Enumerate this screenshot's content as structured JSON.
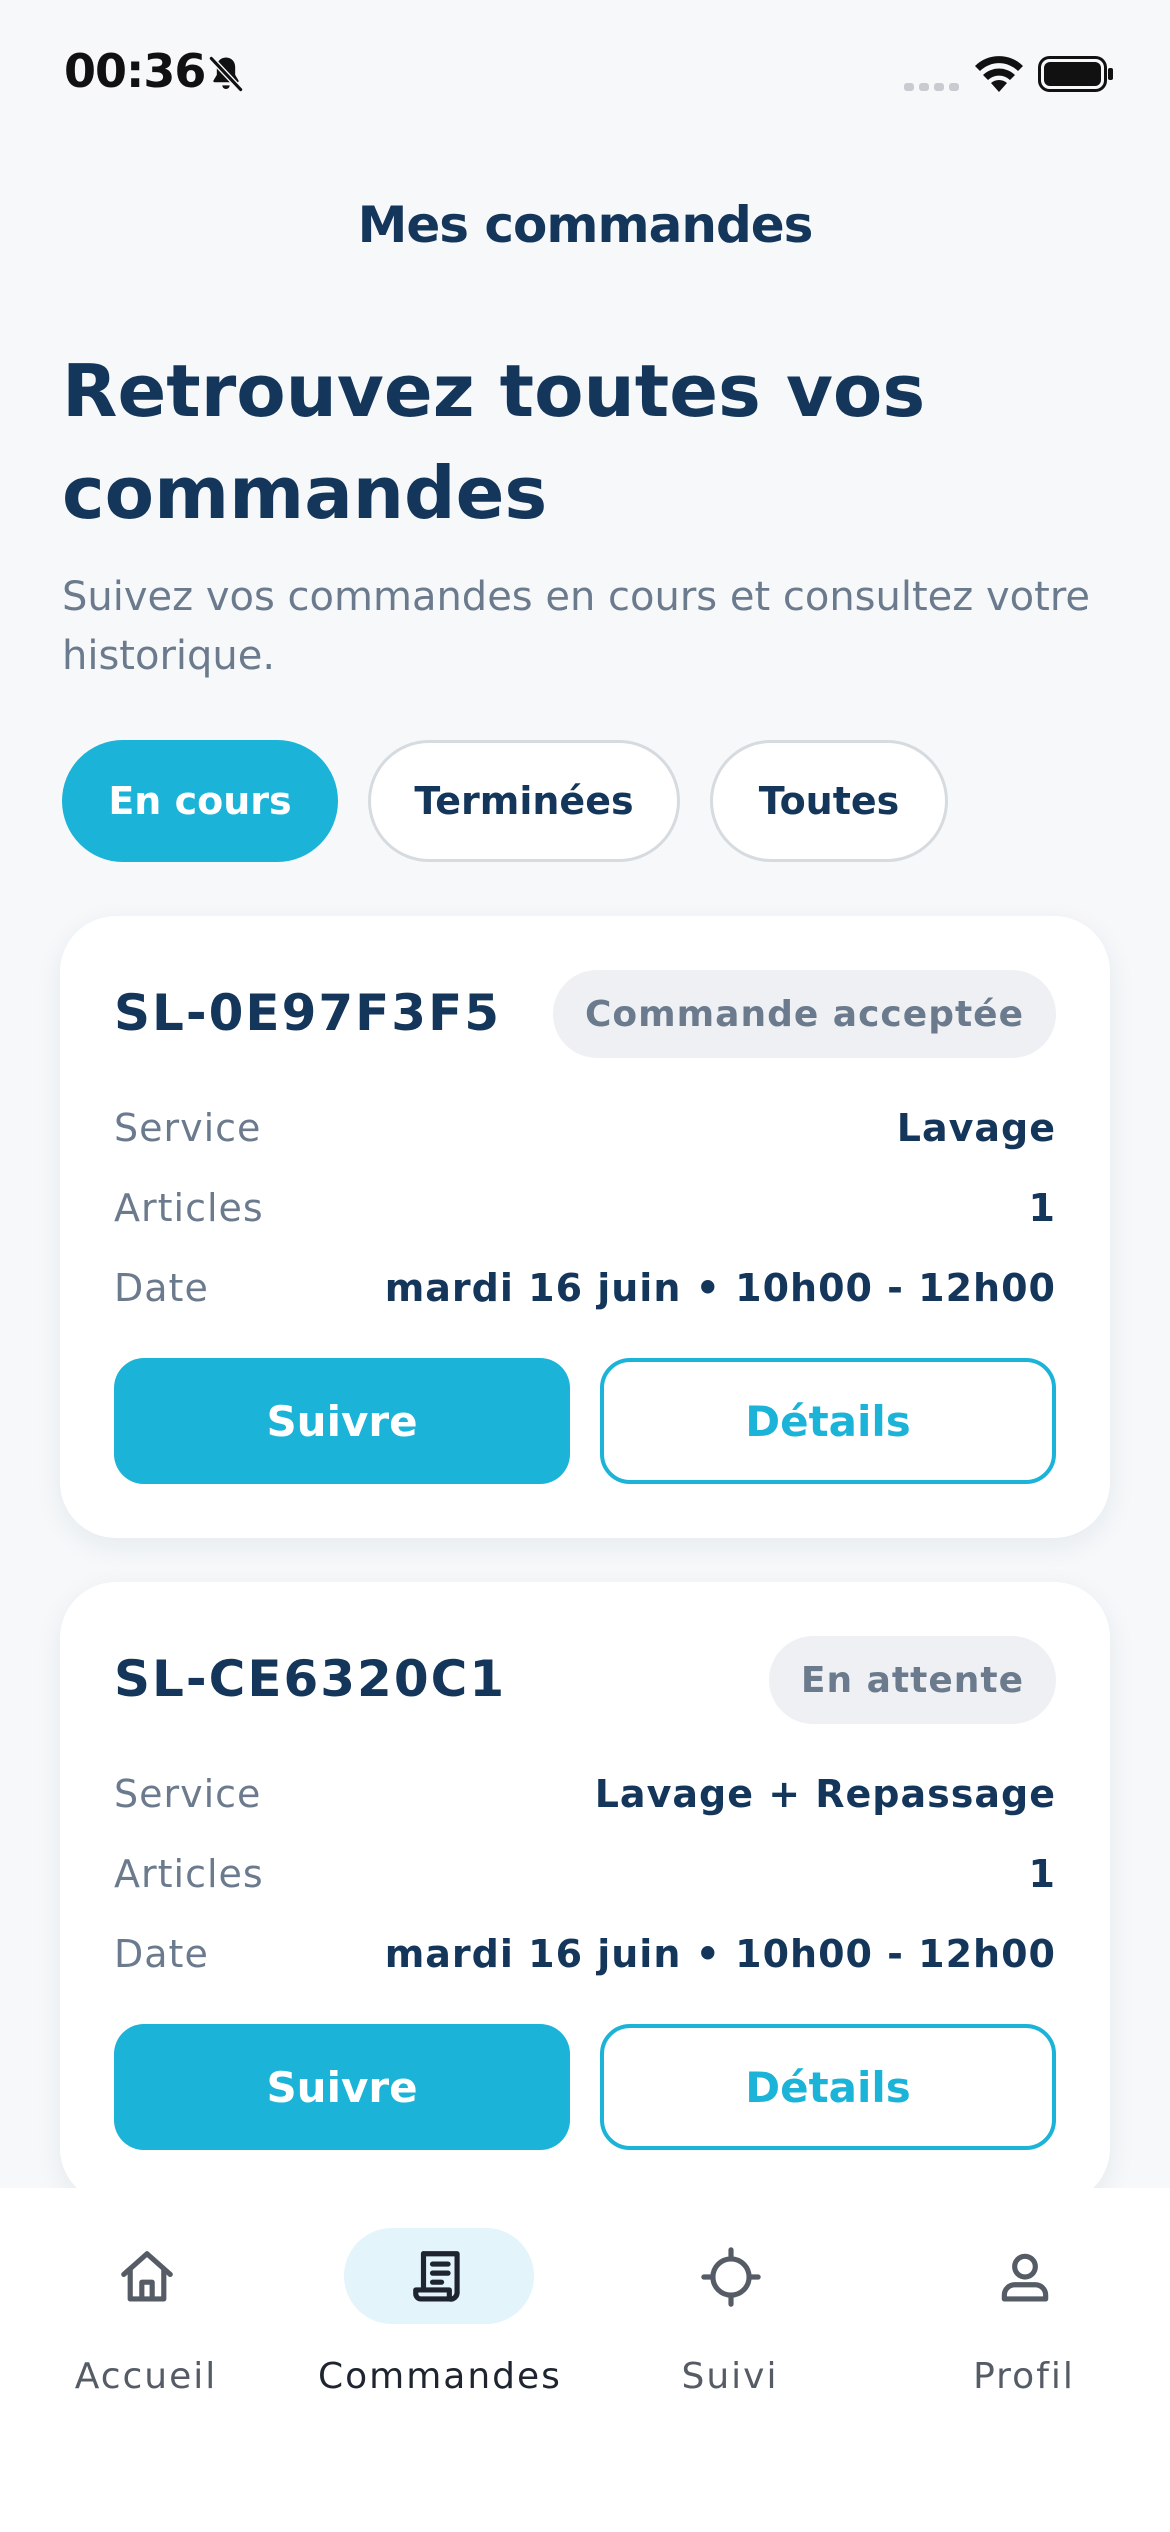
{
  "status_bar": {
    "time": "00:36",
    "icons": [
      "bell-slash-icon",
      "signal-icon",
      "wifi-icon",
      "battery-icon"
    ]
  },
  "header": {
    "title": "Mes commandes"
  },
  "intro": {
    "heading": "Retrouvez toutes vos commandes",
    "subtitle": "Suivez vos commandes en cours et consultez votre historique."
  },
  "filters": {
    "tabs": [
      {
        "label": "En cours",
        "active": true
      },
      {
        "label": "Terminées",
        "active": false
      },
      {
        "label": "Toutes",
        "active": false
      }
    ]
  },
  "orders": [
    {
      "id": "SL-0E97F3F5",
      "status": "Commande acceptée",
      "rows": [
        {
          "label": "Service",
          "value": "Lavage"
        },
        {
          "label": "Articles",
          "value": "1"
        },
        {
          "label": "Date",
          "value": "mardi 16 juin • 10h00 - 12h00"
        }
      ],
      "primary_action": "Suivre",
      "secondary_action": "Détails"
    },
    {
      "id": "SL-CE6320C1",
      "status": "En attente",
      "rows": [
        {
          "label": "Service",
          "value": "Lavage + Repassage"
        },
        {
          "label": "Articles",
          "value": "1"
        },
        {
          "label": "Date",
          "value": "mardi 16 juin • 10h00 - 12h00"
        }
      ],
      "primary_action": "Suivre",
      "secondary_action": "Détails"
    }
  ],
  "tab_bar": {
    "items": [
      {
        "label": "Accueil",
        "icon": "home-icon",
        "active": false
      },
      {
        "label": "Commandes",
        "icon": "receipt-icon",
        "active": true
      },
      {
        "label": "Suivi",
        "icon": "crosshair-icon",
        "active": false
      },
      {
        "label": "Profil",
        "icon": "user-icon",
        "active": false
      }
    ]
  },
  "colors": {
    "accent": "#1bb3d8",
    "primary_text": "#14365a",
    "secondary_text": "#6b7b8d",
    "background": "#f6f8fa",
    "badge_background": "#eef0f3",
    "active_tab_highlight": "#e3f4fa"
  }
}
